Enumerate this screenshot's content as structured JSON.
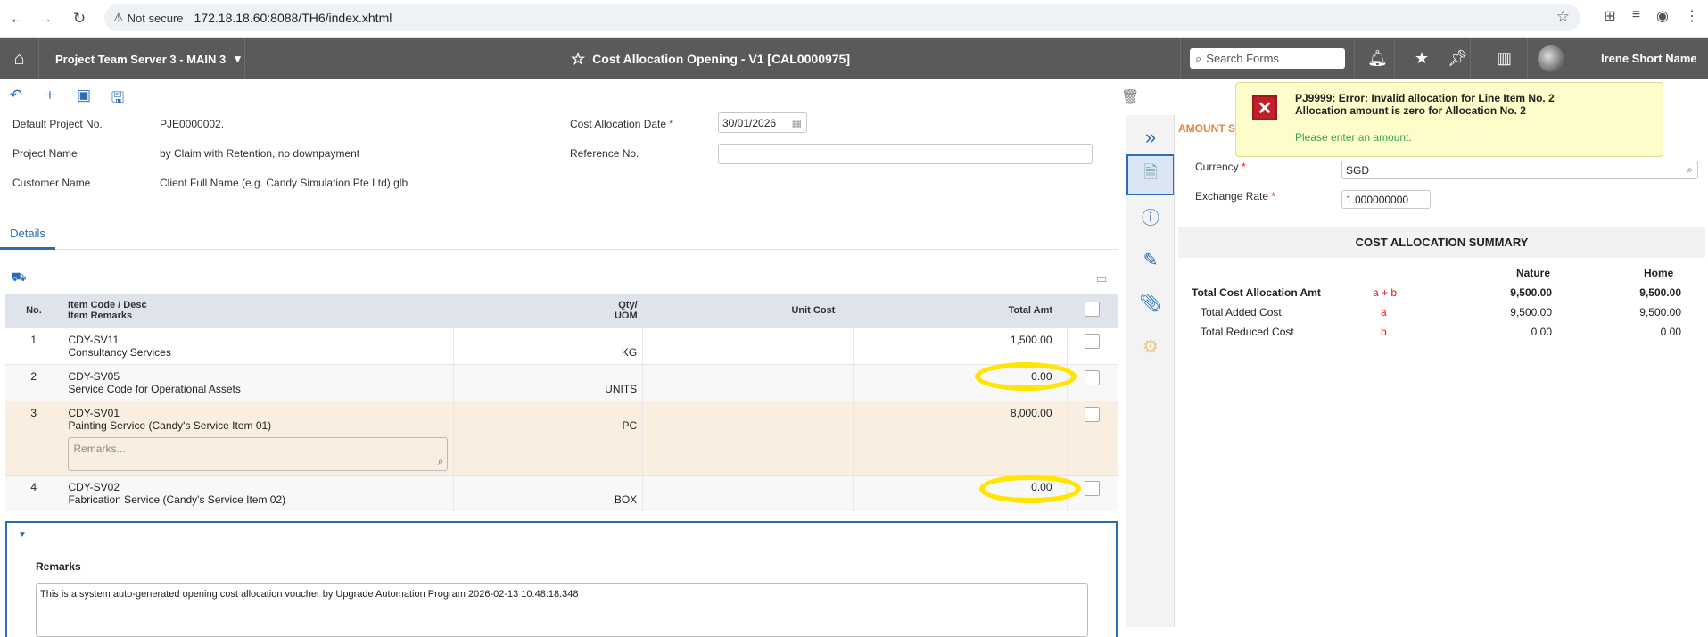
{
  "browser": {
    "security_label": "Not secure",
    "url": "172.18.18.60:8088/TH6/index.xhtml"
  },
  "appbar": {
    "server": "Project Team Server 3 - MAIN 3",
    "title": "Cost Allocation Opening - V1 [CAL0000975]",
    "search_placeholder": "Search Forms",
    "user_name": "Irene Short Name"
  },
  "header": {
    "default_project_label": "Default Project No.",
    "default_project_value": "PJE0000002.",
    "project_name_label": "Project Name",
    "project_name_value": "by Claim with Retention, no downpayment",
    "customer_name_label": "Customer Name",
    "customer_name_value": "Client Full Name (e.g. Candy Simulation Pte Ltd) glb",
    "date_label": "Cost Allocation Date",
    "date_value": "30/01/2026",
    "reference_label": "Reference No.",
    "reference_value": ""
  },
  "tabs": {
    "details": "Details"
  },
  "grid": {
    "col_no": "No.",
    "col_item": "Item Code / Desc",
    "col_item2": "Item Remarks",
    "col_qty": "Qty/",
    "col_uom": "UOM",
    "col_unit_cost": "Unit Cost",
    "col_total": "Total Amt",
    "rows": [
      {
        "no": "1",
        "code": "CDY-SV11",
        "desc": "Consultancy Services",
        "uom": "KG",
        "total": "1,500.00"
      },
      {
        "no": "2",
        "code": "CDY-SV05",
        "desc": "Service Code for Operational Assets",
        "uom": "UNITS",
        "total": "0.00"
      },
      {
        "no": "3",
        "code": "CDY-SV01",
        "desc": "Painting Service (Candy's Service Item 01)",
        "uom": "PC",
        "total": "8,000.00",
        "remarks_placeholder": "Remarks..."
      },
      {
        "no": "4",
        "code": "CDY-SV02",
        "desc": "Fabrication Service (Candy's Service Item 02)",
        "uom": "BOX",
        "total": "0.00"
      }
    ]
  },
  "remarks": {
    "title": "Remarks",
    "text": "This is a system auto-generated opening cost allocation voucher by Upgrade Automation Program 2026-02-13 10:48:18.348"
  },
  "amount_panel": {
    "head": "AMOUNT S",
    "currency_label": "Currency",
    "currency_value": "SGD",
    "rate_label": "Exchange Rate",
    "rate_value": "1.000000000"
  },
  "summary": {
    "title": "COST ALLOCATION SUMMARY",
    "col_nature": "Nature",
    "col_home": "Home",
    "rows": [
      {
        "label": "Total Cost Allocation Amt",
        "formula": "a + b",
        "nature": "9,500.00",
        "home": "9,500.00"
      },
      {
        "label": "Total Added Cost",
        "formula": "a",
        "nature": "9,500.00",
        "home": "9,500.00"
      },
      {
        "label": "Total Reduced Cost",
        "formula": "b",
        "nature": "0.00",
        "home": "0.00"
      }
    ]
  },
  "toast": {
    "line1": "PJ9999: Error: Invalid allocation for Line Item No. 2",
    "line2": "Allocation amount is zero for Allocation No. 2",
    "line3": "Please enter an amount."
  },
  "colors": {
    "accent": "#2a6db5",
    "appbar": "#5a5a5a",
    "highlight": "#ffe500",
    "error": "#c0202a"
  }
}
